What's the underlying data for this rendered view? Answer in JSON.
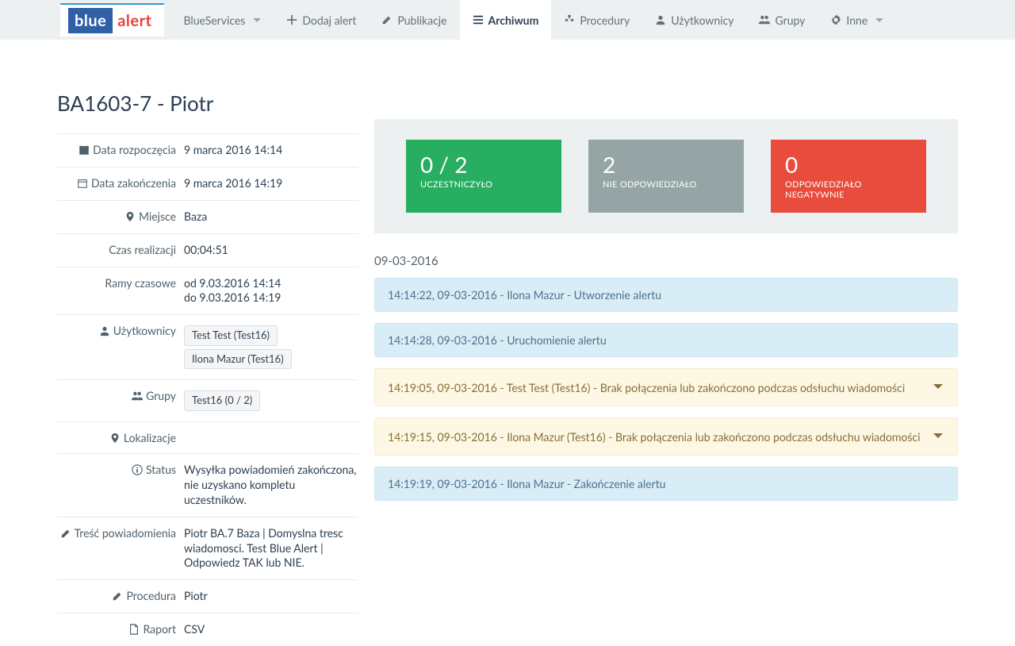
{
  "logo": {
    "blue": "blue",
    "alert": "alert"
  },
  "nav": {
    "blueservices": "BlueServices",
    "dodaj_alert": "Dodaj alert",
    "publikacje": "Publikacje",
    "archiwum": "Archiwum",
    "procedury": "Procedury",
    "uzytkownicy": "Użytkownicy",
    "grupy": "Grupy",
    "inne": "Inne"
  },
  "title": "BA1603-7 - Piotr",
  "details": {
    "start_label": "Data rozpoczęcia",
    "start_value": "9 marca 2016 14:14",
    "end_label": "Data zakończenia",
    "end_value": "9 marca 2016 14:19",
    "place_label": "Miejsce",
    "place_value": "Baza",
    "dur_label": "Czas realizacji",
    "dur_value": "00:04:51",
    "frame_label": "Ramy czasowe",
    "frame_value": "od 9.03.2016 14:14\ndo 9.03.2016 14:19",
    "users_label": "Użytkownicy",
    "users": [
      "Test Test (Test16)",
      "Ilona Mazur (Test16)"
    ],
    "groups_label": "Grupy",
    "groups": [
      "Test16 (0 / 2)"
    ],
    "loc_label": "Lokalizacje",
    "loc_value": "",
    "status_label": "Status",
    "status_value": "Wysyłka powiadomień zakończona, nie uzyskano kompletu uczestników.",
    "msg_label": "Treść powiadomienia",
    "msg_value": "Piotr BA.7 Baza | Domyslna tresc wiadomosci. Test Blue Alert | Odpowiedz TAK lub NIE.",
    "proc_label": "Procedura",
    "proc_value": "Piotr",
    "report_label": "Raport",
    "report_value": "CSV"
  },
  "stats": {
    "participated": {
      "num": "0 / 2",
      "label": "UCZESTNICZYŁO"
    },
    "no_reply": {
      "num": "2",
      "label": "NIE ODPOWIEDZIAŁO"
    },
    "neg_reply": {
      "num": "0",
      "label": "ODPOWIEDZIAŁO NEGATYWNIE"
    }
  },
  "log": {
    "date": "09-03-2016",
    "entries": [
      {
        "kind": "info",
        "text": "14:14:22, 09-03-2016 - Ilona Mazur - Utworzenie alertu",
        "expand": false
      },
      {
        "kind": "info",
        "text": "14:14:28, 09-03-2016 - Uruchomienie alertu",
        "expand": false
      },
      {
        "kind": "warn",
        "text": "14:19:05, 09-03-2016 - Test Test (Test16) - Brak połączenia lub zakończono podczas odsłuchu wiadomości",
        "expand": true
      },
      {
        "kind": "warn",
        "text": "14:19:15, 09-03-2016 - Ilona Mazur (Test16) - Brak połączenia lub zakończono podczas odsłuchu wiadomości",
        "expand": true
      },
      {
        "kind": "info",
        "text": "14:19:19, 09-03-2016 - Ilona Mazur - Zakończenie alertu",
        "expand": false
      }
    ]
  }
}
